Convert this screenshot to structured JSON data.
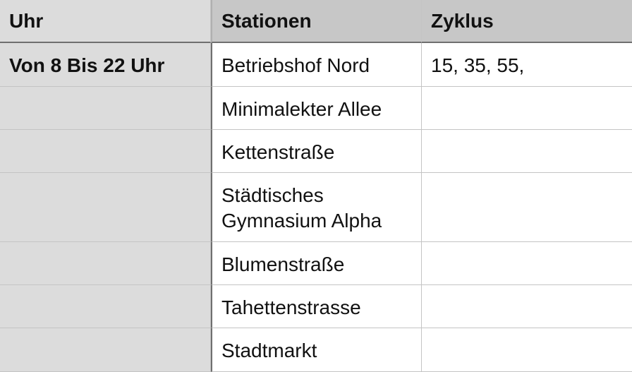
{
  "table": {
    "headers": [
      "Uhr",
      "Stationen",
      "Zyklus"
    ],
    "time_label": "Von 8 Bis 22 Uhr",
    "stations": [
      "Betriebshof Nord",
      "Minimalekter Allee",
      "Kettenstraße",
      "Städtisches Gymnasium Alpha",
      "Blumenstraße",
      "Tahettenstrasse",
      "Stadtmarkt"
    ],
    "station_4_line1": "Städtisches",
    "station_4_line2": "Gymnasium Alpha",
    "cycle": "15, 35, 55,"
  }
}
